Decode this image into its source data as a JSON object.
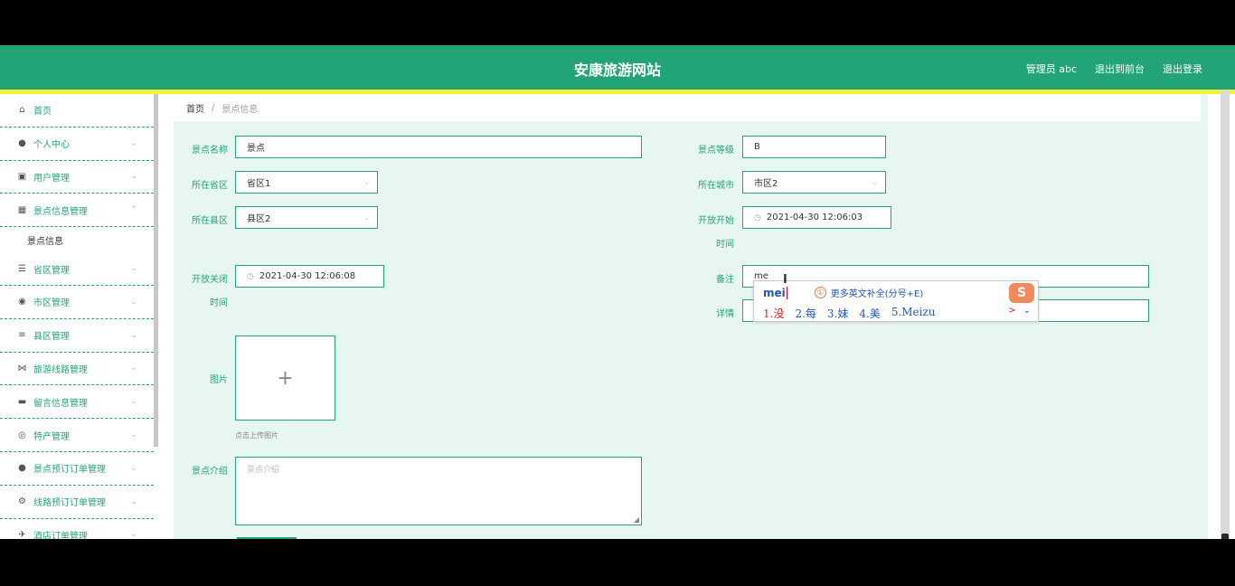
{
  "header": {
    "title": "安康旅游网站",
    "user_label": "管理员 abc",
    "front_link": "退出到前台",
    "logout_link": "退出登录"
  },
  "breadcrumb": {
    "home": "首页",
    "separator": "/",
    "current": "景点信息"
  },
  "sidebar": {
    "items": [
      {
        "label": "首页",
        "icon": "home-icon"
      },
      {
        "label": "个人中心",
        "icon": "user-icon"
      },
      {
        "label": "用户管理",
        "icon": "users-icon"
      },
      {
        "label": "景点信息管理",
        "icon": "building-icon"
      },
      {
        "label": "景点信息",
        "sub": true
      },
      {
        "label": "省区管理",
        "icon": "list-icon"
      },
      {
        "label": "市区管理",
        "icon": "globe-icon"
      },
      {
        "label": "县区管理",
        "icon": "menu-icon"
      },
      {
        "label": "旅游线路管理",
        "icon": "route-icon"
      },
      {
        "label": "留言信息管理",
        "icon": "comment-icon"
      },
      {
        "label": "特产管理",
        "icon": "gift-icon"
      },
      {
        "label": "景点预订订单管理",
        "icon": "user-icon"
      },
      {
        "label": "线路预订订单管理",
        "icon": "gear-icon"
      },
      {
        "label": "酒店订单管理",
        "icon": "bird-icon"
      }
    ]
  },
  "form": {
    "name_label": "景点名称",
    "name_value": "景点",
    "level_label": "景点等级",
    "level_value": "B",
    "province_label": "所在省区",
    "province_value": "省区1",
    "city_label": "所在城市",
    "city_value": "市区2",
    "county_label": "所在县区",
    "county_value": "县区2",
    "open_label": "开放开始",
    "open_label2": "时间",
    "open_value": "2021-04-30 12:06:03",
    "close_label": "开放关闭",
    "close_label2": "时间",
    "close_value": "2021-04-30 12:06:08",
    "notes_label": "备注",
    "notes_value": "me",
    "detail_label": "详情",
    "image_label": "图片",
    "upload_plus": "+",
    "upload_hint": "点击上传图片",
    "intro_label": "景点介绍",
    "intro_placeholder": "景点介绍"
  },
  "ime": {
    "pinyin": "mei",
    "more_num": "①",
    "more_text": "更多英文补全(分号+E)",
    "candidates": [
      "1.没",
      "2.每",
      "3.妹",
      "4.美",
      "5.Meizu"
    ],
    "next": ">",
    "expand": "⌄",
    "logo": "S"
  },
  "colors": {
    "accent": "#23a476",
    "highlight": "#f4f13a",
    "panel": "#e8f6f1"
  }
}
